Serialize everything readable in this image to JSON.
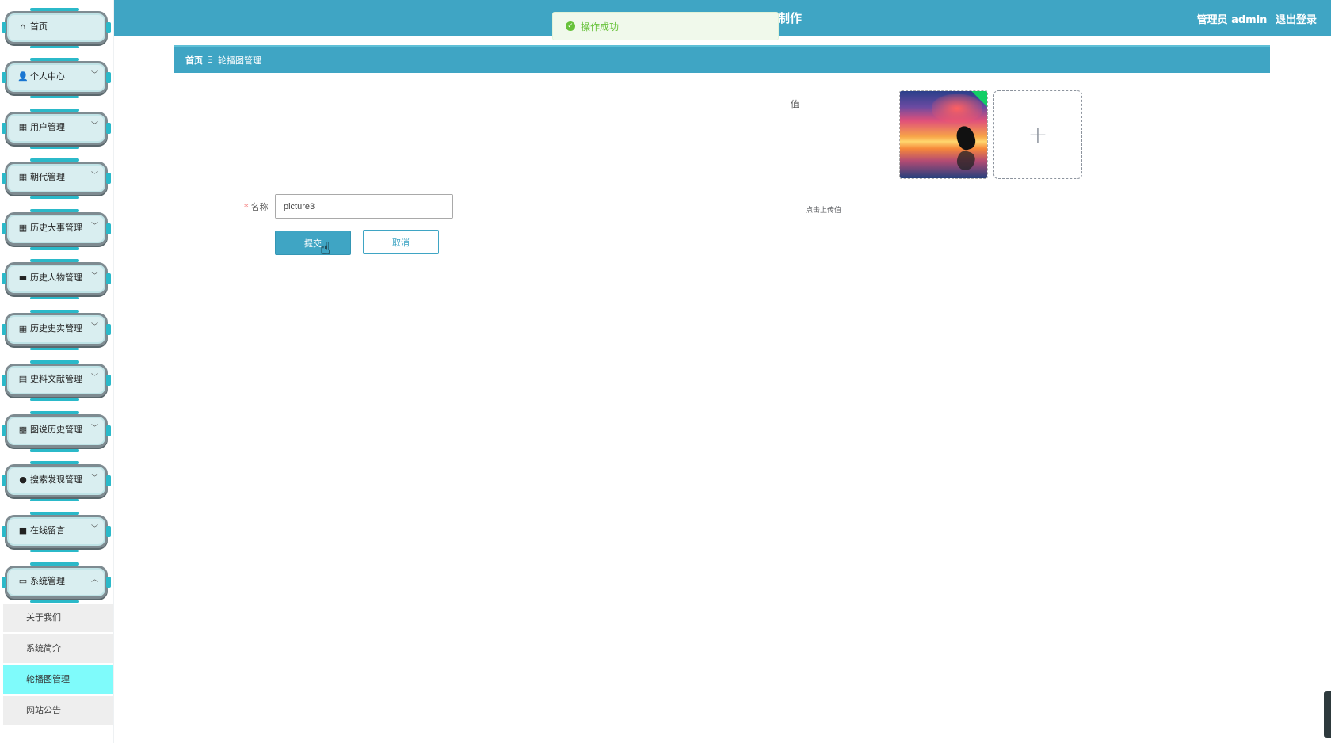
{
  "header": {
    "title": "制作",
    "user_label": "管理员 admin",
    "logout_label": "退出登录"
  },
  "toast": {
    "message": "操作成功"
  },
  "sidebar": {
    "items": [
      {
        "label": "首页",
        "icon": "home-icon",
        "glyph": "⌂"
      },
      {
        "label": "个人中心",
        "icon": "user-icon",
        "glyph": "👤"
      },
      {
        "label": "用户管理",
        "icon": "grid-icon",
        "glyph": "▦"
      },
      {
        "label": "朝代管理",
        "icon": "grid-icon",
        "glyph": "▦"
      },
      {
        "label": "历史大事管理",
        "icon": "grid-icon",
        "glyph": "▦"
      },
      {
        "label": "历史人物管理",
        "icon": "briefcase-icon",
        "glyph": "▬"
      },
      {
        "label": "历史史实管理",
        "icon": "grid-icon",
        "glyph": "▦"
      },
      {
        "label": "史料文献管理",
        "icon": "clipboard-icon",
        "glyph": "▤"
      },
      {
        "label": "图说历史管理",
        "icon": "image-icon",
        "glyph": "▩"
      },
      {
        "label": "搜索发现管理",
        "icon": "location-icon",
        "glyph": "●"
      },
      {
        "label": "在线留言",
        "icon": "video-icon",
        "glyph": "■"
      },
      {
        "label": "系统管理",
        "icon": "monitor-icon",
        "glyph": "▭"
      }
    ],
    "subitems": [
      {
        "label": "关于我们"
      },
      {
        "label": "系统简介"
      },
      {
        "label": "轮播图管理",
        "active": true
      },
      {
        "label": "网站公告"
      }
    ]
  },
  "breadcrumb": {
    "home": "首页",
    "separator": "Ξ",
    "current": "轮播图管理"
  },
  "form": {
    "name_label": "名称",
    "name_value": "picture3",
    "value_label": "值",
    "upload_hint": "点击上传值",
    "submit_label": "提交",
    "cancel_label": "取消"
  },
  "colors": {
    "primary": "#3fa5c4",
    "active_submenu": "#7ffbfb",
    "success": "#67c23a"
  }
}
